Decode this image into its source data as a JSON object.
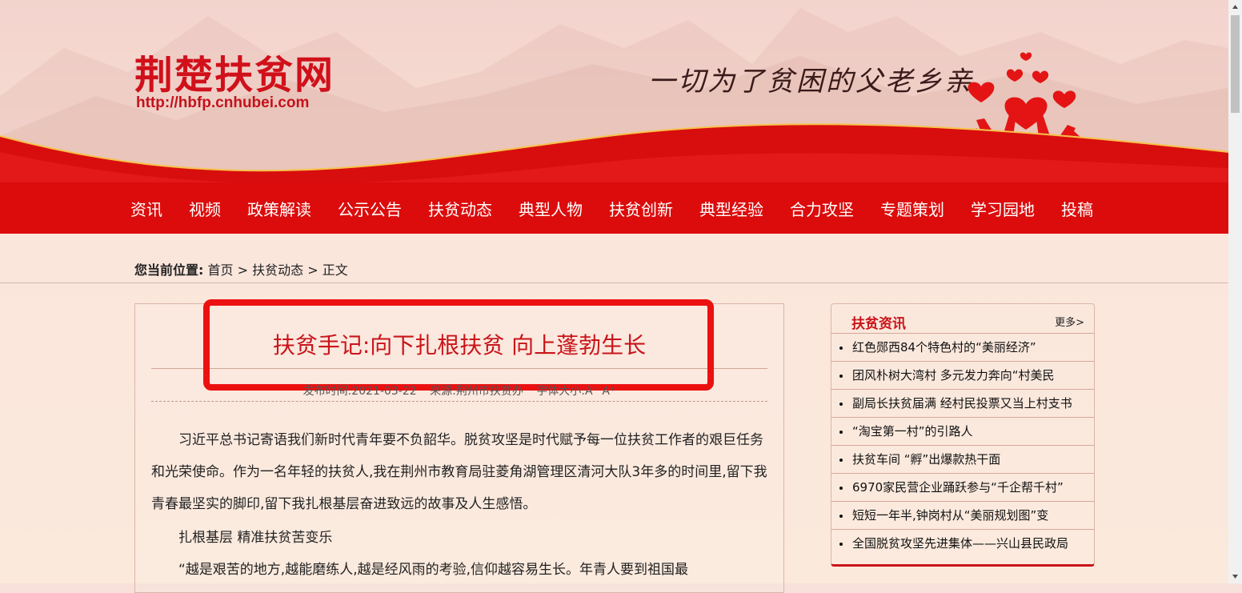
{
  "header": {
    "site_title": "荆楚扶贫网",
    "site_url": "http://hbfp.cnhubei.com",
    "slogan": "一切为了贫困的父老乡亲",
    "colors": {
      "brand_red": "#dc0c0c",
      "title_red": "#c9141a"
    }
  },
  "nav": {
    "items": [
      "资讯",
      "视频",
      "政策解读",
      "公示公告",
      "扶贫动态",
      "典型人物",
      "扶贫创新",
      "典型经验",
      "合力攻坚",
      "专题策划",
      "学习园地",
      "投稿"
    ]
  },
  "breadcrumb": {
    "label": "您当前位置:",
    "home": "首页",
    "sep1": ">",
    "section": "扶贫动态",
    "sep2": ">",
    "current": "正文"
  },
  "article": {
    "title": "扶贫手记:向下扎根扶贫 向上蓬勃生长",
    "meta": {
      "date": "发布时间:2021-03-22",
      "source": "来源:荆州市扶贫办",
      "font_size_label": "字体大小:A⁻ A⁺"
    },
    "paragraphs": [
      "习近平总书记寄语我们新时代青年要不负韶华。脱贫攻坚是时代赋予每一位扶贫工作者的艰巨任务和光荣使命。作为一名年轻的扶贫人,我在荆州市教育局驻菱角湖管理区清河大队3年多的时间里,留下我青春最坚实的脚印,留下我扎根基层奋进致远的故事及人生感悟。",
      "扎根基层 精准扶贫苦变乐",
      "“越是艰苦的地方,越能磨练人,越是经风雨的考验,信仰越容易生长。年青人要到祖国最"
    ]
  },
  "sidebar": {
    "title": "扶贫资讯",
    "more": "更多>",
    "items": [
      "红色郧西84个特色村的“美丽经济”",
      "团风朴树大湾村 多元发力奔向“村美民",
      "副局长扶贫届满 经村民投票又当上村支书",
      "“淘宝第一村”的引路人",
      "扶贫车间 “孵”出爆款热干面",
      "6970家民营企业踊跃参与“千企帮千村”",
      "短短一年半,钟岗村从“美丽规划图”变",
      "全国脱贫攻坚先进集体——兴山县民政局"
    ]
  }
}
